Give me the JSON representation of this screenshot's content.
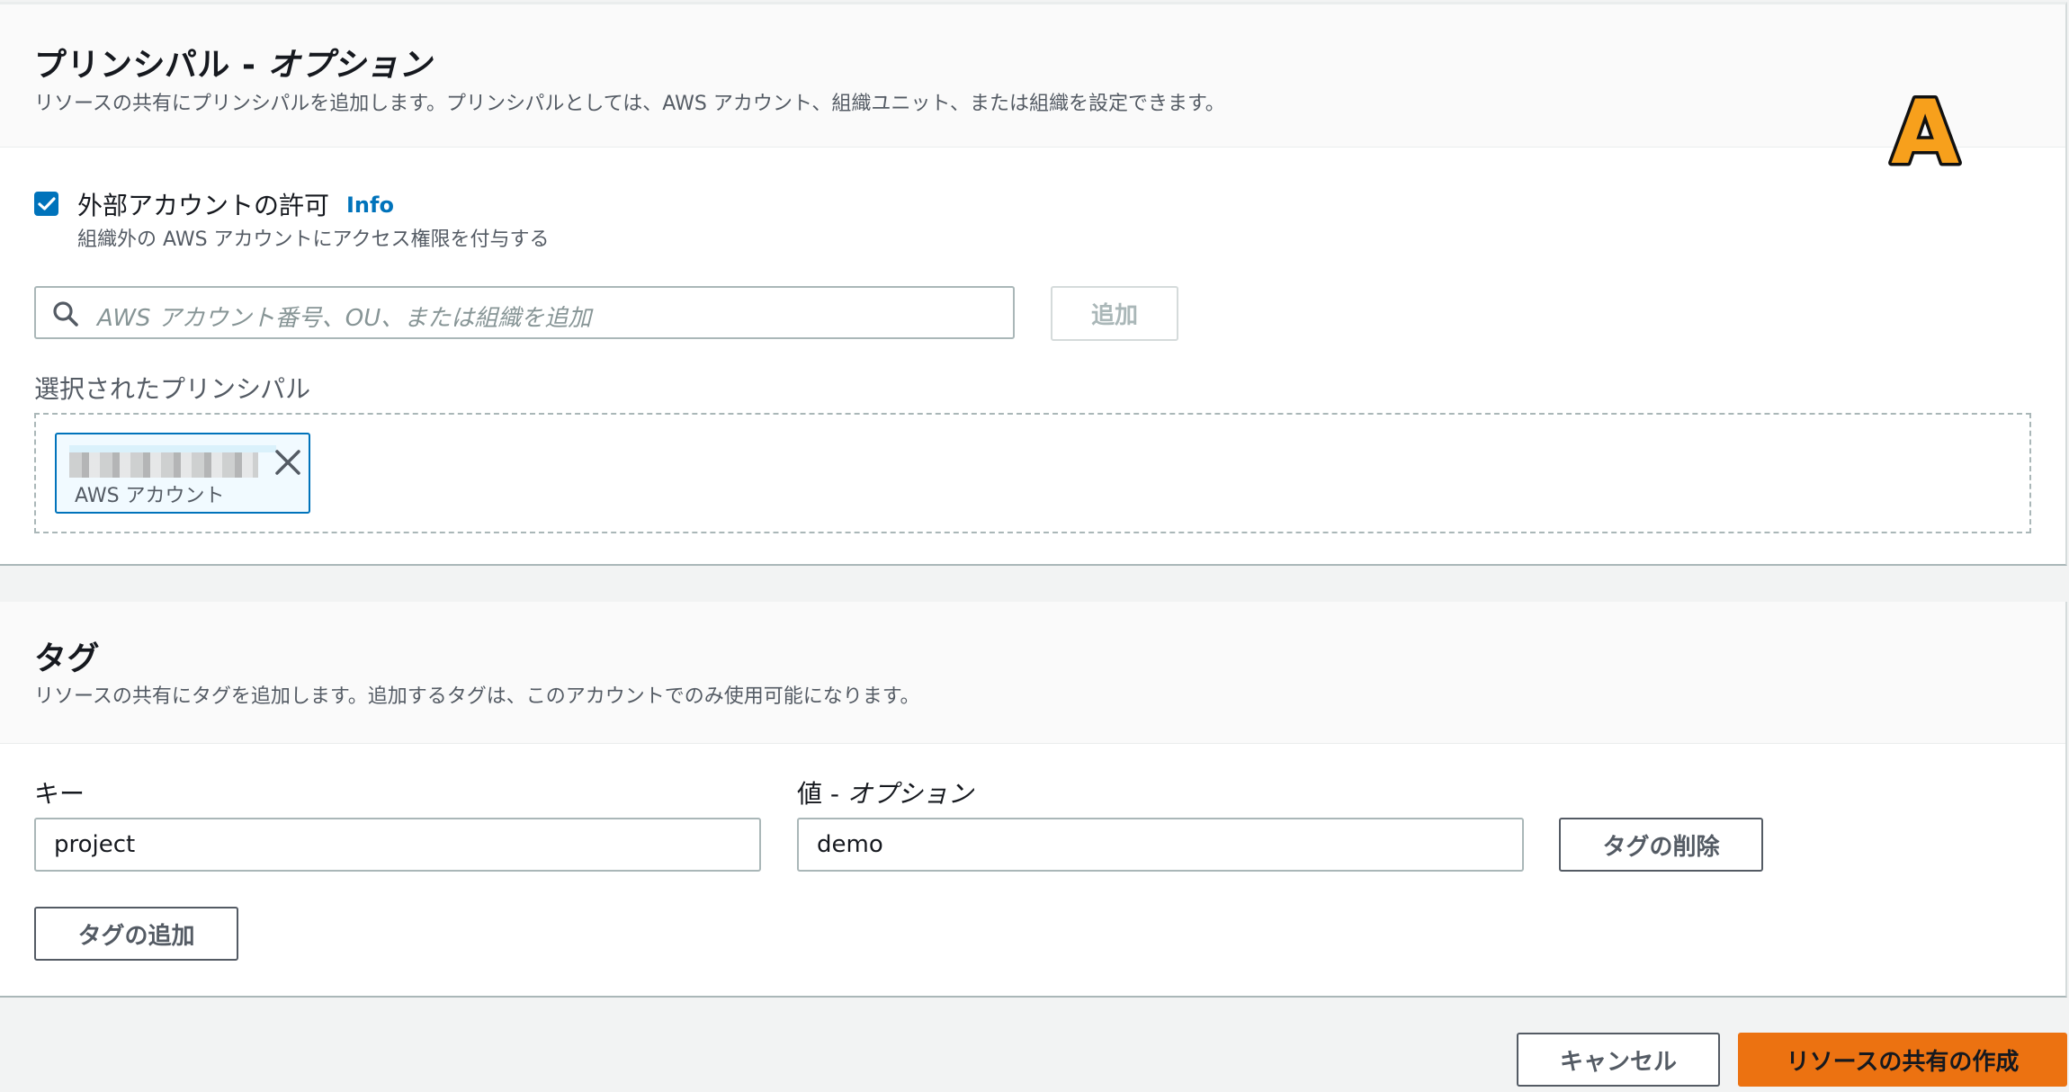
{
  "principal": {
    "title": "プリンシパル - ",
    "title_optional": "オプション",
    "description": "リソースの共有にプリンシパルを追加します。プリンシパルとしては、AWS アカウント、組織ユニット、または組織を設定できます。",
    "badge_letter": "A",
    "badge_color": "#f7a01c",
    "allow_external": {
      "checked": true,
      "label": "外部アカウントの許可",
      "info_label": "Info",
      "description": "組織外の AWS アカウントにアクセス権限を付与する"
    },
    "search": {
      "placeholder": "AWS アカウント番号、OU、または組織を追加",
      "icon": "search-icon"
    },
    "add_button_label": "追加",
    "selected_label": "選択されたプリンシパル",
    "selected": [
      {
        "type_label": "AWS アカウント"
      }
    ]
  },
  "tags": {
    "title": "タグ",
    "description": "リソースの共有にタグを追加します。追加するタグは、このアカウントでのみ使用可能になります。",
    "key_label": "キー",
    "value_label": "値 - ",
    "value_label_optional": "オプション",
    "rows": [
      {
        "key": "project",
        "value": "demo"
      }
    ],
    "remove_button_label": "タグの削除",
    "add_button_label": "タグの追加"
  },
  "footer": {
    "cancel_label": "キャンセル",
    "create_label": "リソースの共有の作成"
  },
  "colors": {
    "accent_blue": "#0073bb",
    "primary_orange": "#ec7211"
  }
}
